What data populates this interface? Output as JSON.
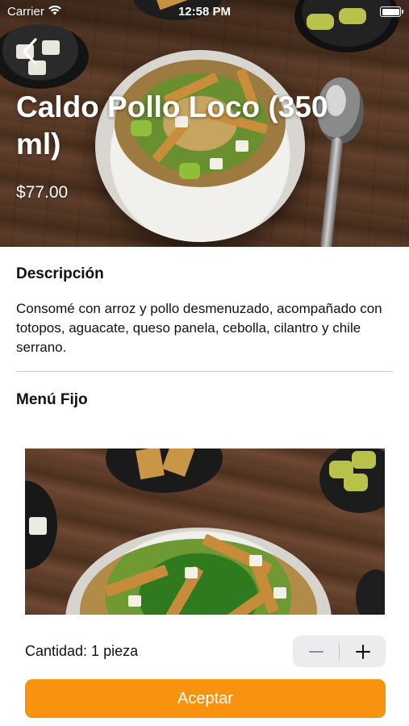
{
  "status_bar": {
    "carrier": "Carrier",
    "time": "12:58 PM"
  },
  "product": {
    "title": "Caldo Pollo Loco (350 ml)",
    "price": "$77.00"
  },
  "description": {
    "heading": "Descripción",
    "text": "Consomé con arroz y pollo desmenuzado, acompañado con totopos, aguacate, queso panela, cebolla, cilantro y chile serrano."
  },
  "menu": {
    "heading": "Menú Fijo"
  },
  "quantity": {
    "label": "Cantidad: 1 pieza"
  },
  "actions": {
    "accept_label": "Aceptar"
  },
  "colors": {
    "accent": "#f7930f",
    "stepper_bg": "#ececee"
  },
  "icons": [
    "wifi-icon",
    "battery-icon",
    "chevron-left-icon",
    "minus-icon",
    "plus-icon"
  ]
}
